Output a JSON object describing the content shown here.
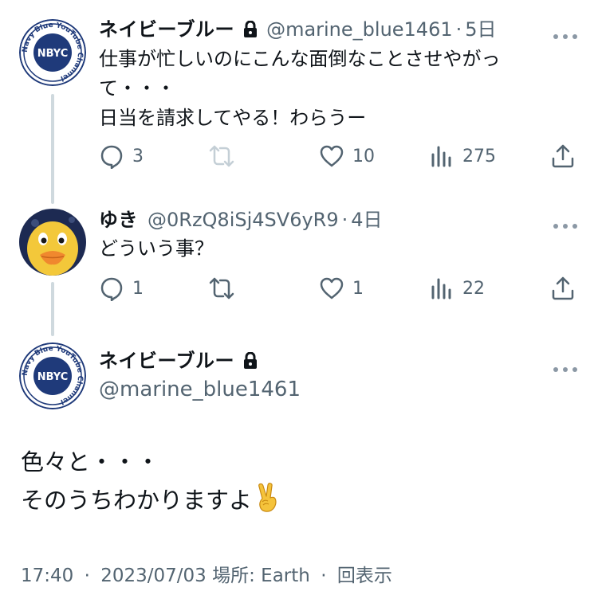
{
  "tweet1": {
    "name": "ネイビーブルー",
    "handle": "@marine_blue1461",
    "sep": "·",
    "time": "5日",
    "avatar_text": "NBYC",
    "avatar_ring_text": "Navy Blue YouTube Channel",
    "lines": [
      "仕事が忙しいのにこんな面倒なことさせやがっ",
      "て・・・",
      "日当を請求してやる！わらうー"
    ],
    "replies": "3",
    "likes": "10",
    "views": "275"
  },
  "tweet2": {
    "name": "ゆき",
    "handle": "@0RzQ8iSj4SV6yR9",
    "sep": "·",
    "time": "4日",
    "lines": [
      "どういう事？"
    ],
    "replies": "1",
    "likes": "1",
    "views": "22"
  },
  "main": {
    "name": "ネイビーブルー",
    "handle": "@marine_blue1461",
    "avatar_text": "NBYC",
    "avatar_ring_text": "Navy Blue YouTube Channel",
    "lines": [
      "色々と・・・",
      "そのうちわかりますよ"
    ],
    "emoji": "victory-hand",
    "meta": {
      "time": "17:40",
      "date": "2023/07/03",
      "location": "場所: Earth",
      "views": "回表示",
      "sep": "·"
    }
  },
  "colors": {
    "text": "#0f1419",
    "secondary": "#536471",
    "line": "#cfd9de",
    "navy": "#1f3a7a"
  },
  "icons": [
    "lock-icon",
    "more-icon",
    "reply-icon",
    "retweet-icon",
    "like-icon",
    "views-icon",
    "share-icon"
  ]
}
